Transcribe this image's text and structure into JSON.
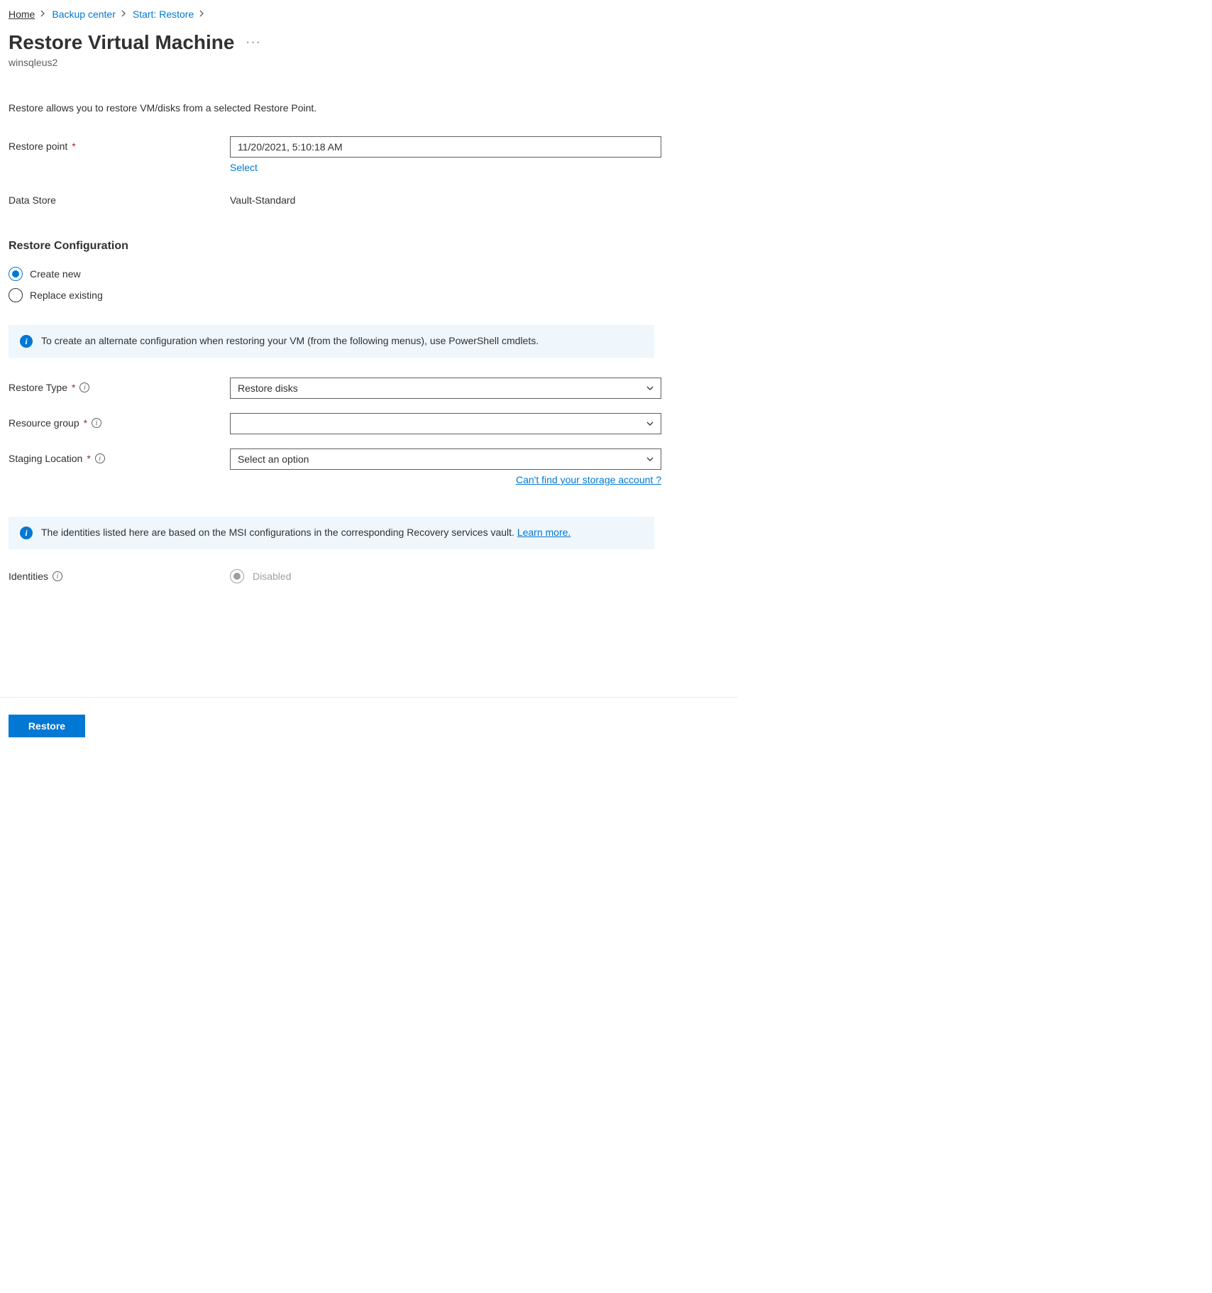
{
  "breadcrumb": {
    "home": "Home",
    "backup_center": "Backup center",
    "start_restore": "Start: Restore"
  },
  "page": {
    "title": "Restore Virtual Machine",
    "subtitle": "winsqleus2",
    "description": "Restore allows you to restore VM/disks from a selected Restore Point."
  },
  "restore_point": {
    "label": "Restore point",
    "value": "11/20/2021, 5:10:18 AM",
    "select_link": "Select"
  },
  "data_store": {
    "label": "Data Store",
    "value": "Vault-Standard"
  },
  "config": {
    "heading": "Restore Configuration",
    "create_new": "Create new",
    "replace_existing": "Replace existing"
  },
  "info_alt_config": "To create an alternate configuration when restoring your VM (from the following menus), use PowerShell cmdlets.",
  "restore_type": {
    "label": "Restore Type",
    "value": "Restore disks"
  },
  "resource_group": {
    "label": "Resource group",
    "value": ""
  },
  "staging_location": {
    "label": "Staging Location",
    "placeholder": "Select an option",
    "helper_link": "Can't find your storage account ?"
  },
  "info_identities": {
    "text": "The identities listed here are based on the MSI configurations in the corresponding Recovery services vault. ",
    "learn_more": "Learn more."
  },
  "identities": {
    "label": "Identities",
    "disabled_label": "Disabled"
  },
  "footer": {
    "restore_btn": "Restore"
  }
}
